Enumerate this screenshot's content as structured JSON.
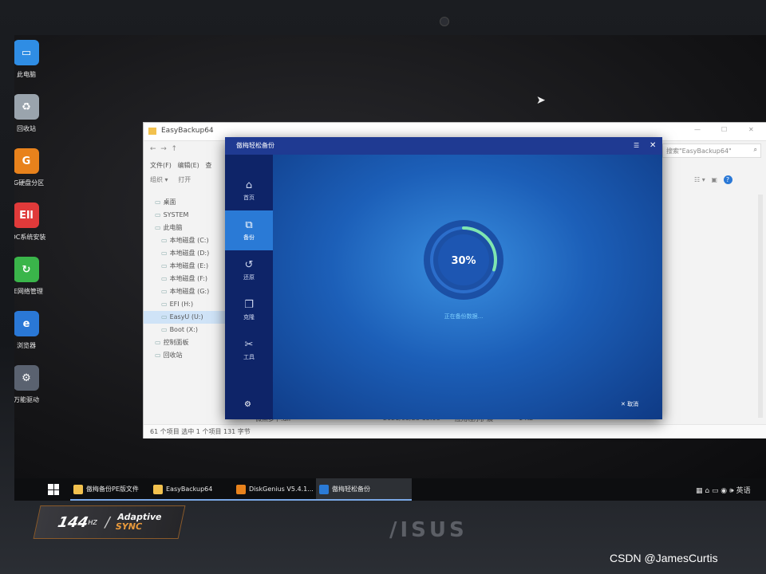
{
  "desktop_icons": [
    {
      "label": "此电脑",
      "icon": "computer-icon",
      "color": "#2f8de4"
    },
    {
      "label": "回收站",
      "icon": "recycle-bin-icon",
      "color": "#9aa4ad"
    },
    {
      "label": "DG硬盘分区",
      "icon": "diskgenius-icon",
      "color": "#e8821c"
    },
    {
      "label": "EDC系统安装",
      "icon": "edc-install-icon",
      "color": "#e03a3a"
    },
    {
      "label": "PE网络管理",
      "icon": "network-manager-icon",
      "color": "#3ab54a"
    },
    {
      "label": "浏览器",
      "icon": "browser-icon",
      "color": "#2a78d6"
    },
    {
      "label": "万能驱动",
      "icon": "driver-gear-icon",
      "color": "#5a6270"
    }
  ],
  "explorer": {
    "title": "EasyBackup64",
    "search_placeholder": "搜索\"EasyBackup64\"",
    "menu": [
      "文件(F)",
      "编辑(E)",
      "查"
    ],
    "toolbar": [
      "组织 ▾",
      "打开"
    ],
    "sidebar": [
      "桌面",
      "SYSTEM",
      "此电脑",
      "本地磁盘 (C:)",
      "本地磁盘 (D:)",
      "本地磁盘 (E:)",
      "本地磁盘 (F:)",
      "本地磁盘 (G:)",
      "EFI (H:)",
      "EasyU (U:)",
      "Boot (X:)",
      "控制面板",
      "回收站"
    ],
    "row_peek": [
      "微黑萝卜.dll",
      "2021/03/23 15:08",
      "应用程序扩展",
      "1 KB"
    ],
    "status": "61 个项目    选中 1 个项目  131 字节"
  },
  "app": {
    "title": "傲梅轻松备份",
    "nav": [
      {
        "label": "首页",
        "icon": "home-icon"
      },
      {
        "label": "备份",
        "icon": "backup-icon",
        "active": true
      },
      {
        "label": "还原",
        "icon": "restore-icon"
      },
      {
        "label": "克隆",
        "icon": "clone-icon"
      },
      {
        "label": "工具",
        "icon": "tools-icon"
      }
    ],
    "progress": {
      "value": 30,
      "text": "30%"
    },
    "status_text": "正在备份数据...",
    "cancel_label": "取消"
  },
  "taskbar": {
    "items": [
      {
        "label": "傲梅备份PE版文件",
        "icon": "folder-icon",
        "color": "#f2c14e"
      },
      {
        "label": "EasyBackup64",
        "icon": "folder-icon",
        "color": "#f2c14e"
      },
      {
        "label": "DiskGenius V5.4.1...",
        "icon": "diskgenius-icon",
        "color": "#e8821c"
      },
      {
        "label": "傲梅轻松备份",
        "icon": "backup-app-icon",
        "color": "#2a7ad6",
        "active": true
      }
    ],
    "tray_text": "英语"
  },
  "hardware": {
    "badge_rate": "144",
    "badge_unit": "HZ",
    "badge_line1": "Adaptive",
    "badge_line2": "SYNC",
    "logo": "/ISUS"
  },
  "watermark": "CSDN @JamesCurtis"
}
